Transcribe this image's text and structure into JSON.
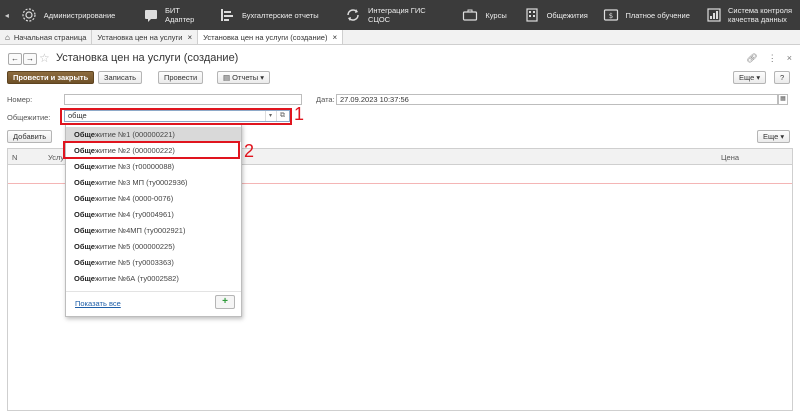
{
  "topbar": {
    "items": [
      {
        "label": "Администрирование",
        "icon": "gear-icon"
      },
      {
        "label": "БИТ Адаптер",
        "icon": "chat-icon"
      },
      {
        "label": "Бухгалтерские отчеты",
        "icon": "report-icon"
      },
      {
        "label": "Интеграция ГИС СЦОС",
        "icon": "sync-icon"
      },
      {
        "label": "Курсы",
        "icon": "briefcase-icon"
      },
      {
        "label": "Общежития",
        "icon": "building-icon"
      },
      {
        "label": "Платное обучение",
        "icon": "money-icon"
      },
      {
        "label": "Система контроля качества данных",
        "icon": "chart-icon"
      }
    ]
  },
  "tabs": [
    {
      "label": "Начальная страница",
      "icon": "home-icon"
    },
    {
      "label": "Установка цен на услуги",
      "close": "×"
    },
    {
      "label": "Установка цен на услуги (создание)",
      "close": "×"
    }
  ],
  "form": {
    "title": "Установка цен на услуги (создание)",
    "nav_back": "←",
    "nav_forward": "→",
    "more_label": "Еще",
    "help_label": "?",
    "buttons": {
      "post_close": "Провести и закрыть",
      "save": "Записать",
      "post": "Провести",
      "reports": "Отчеты"
    },
    "number_label": "Номер:",
    "number_value": "",
    "date_label": "Дата:",
    "date_value": "27.09.2023 10:37:56",
    "dorm_label": "Общежитие:",
    "dorm_value": "обще",
    "add_label": "Добавить",
    "table_more": "Еще",
    "columns": {
      "n": "N",
      "service": "Услу",
      "price": "Цена"
    }
  },
  "dropdown": {
    "items": [
      {
        "bold": "Обще",
        "rest": "житие №1 (000000221)"
      },
      {
        "bold": "Обще",
        "rest": "житие №2 (000000222)"
      },
      {
        "bold": "Обще",
        "rest": "житие №3 (т00000088)"
      },
      {
        "bold": "Обще",
        "rest": "житие №3 МП (ту0002936)"
      },
      {
        "bold": "Обще",
        "rest": "житие №4 (0000-0076)"
      },
      {
        "bold": "Обще",
        "rest": "житие №4 (ту0004961)"
      },
      {
        "bold": "Обще",
        "rest": "житие №4МП (ту0002921)"
      },
      {
        "bold": "Обще",
        "rest": "житие №5 (000000225)"
      },
      {
        "bold": "Обще",
        "rest": "житие №5 (ту0003363)"
      },
      {
        "bold": "Обще",
        "rest": "житие №6А (ту0002582)"
      }
    ],
    "show_all": "Показать все",
    "add": "+"
  },
  "annotations": {
    "marker1": "1",
    "marker2": "2"
  },
  "colors": {
    "accent_primary": "#7a5a2f",
    "highlight": "#e0141e",
    "link": "#1d5ea8"
  }
}
